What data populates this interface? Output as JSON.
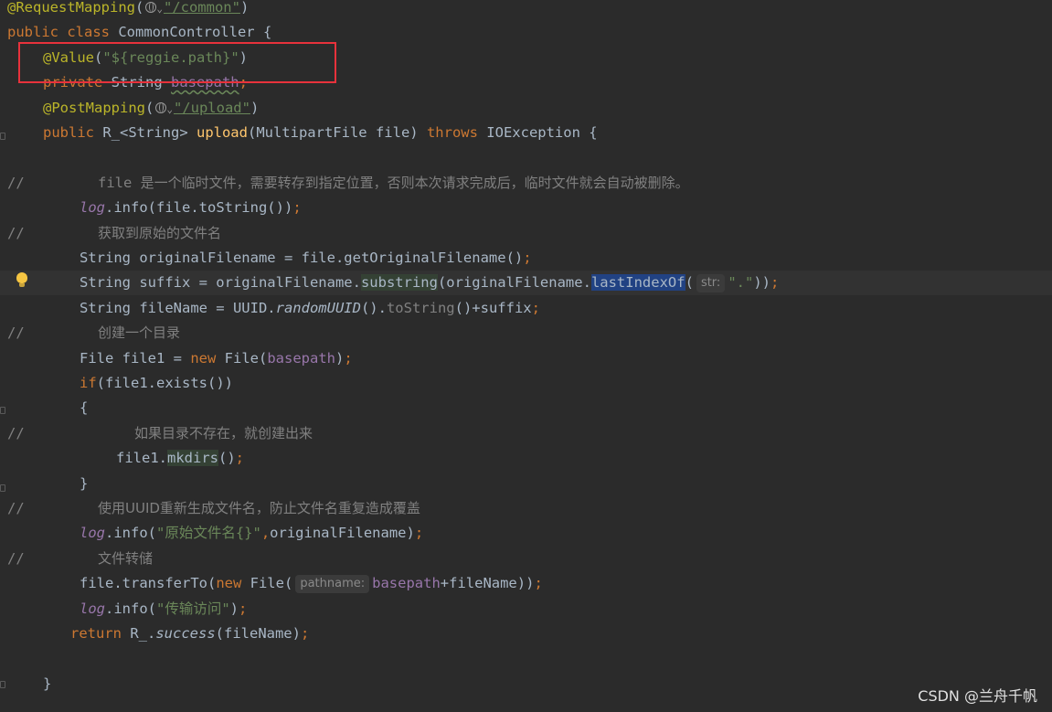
{
  "editor": {
    "lines": [
      {
        "comment": false,
        "indent": 8,
        "caret": false,
        "tokens": [
          {
            "t": "@RequestMapping",
            "c": "ann"
          },
          {
            "t": "(",
            "c": ""
          },
          {
            "t": "",
            "c": "globe"
          },
          {
            "t": "⌄",
            "c": "chev"
          },
          {
            "t": "\"/common\"",
            "c": "str uline"
          },
          {
            "t": ")",
            "c": ""
          }
        ]
      },
      {
        "comment": false,
        "indent": 8,
        "caret": false,
        "tokens": [
          {
            "t": "public class ",
            "c": "kw"
          },
          {
            "t": "CommonController {",
            "c": ""
          }
        ]
      },
      {
        "comment": false,
        "indent": 47,
        "caret": false,
        "tokens": [
          {
            "t": "@Value",
            "c": "ann"
          },
          {
            "t": "(",
            "c": ""
          },
          {
            "t": "\"${reggie.path}\"",
            "c": "str"
          },
          {
            "t": ")",
            "c": ""
          }
        ]
      },
      {
        "comment": false,
        "indent": 47,
        "caret": false,
        "tokens": [
          {
            "t": "private ",
            "c": "kw"
          },
          {
            "t": "String ",
            "c": ""
          },
          {
            "t": "basepath",
            "c": "fld squig"
          },
          {
            "t": ";",
            "c": "kw"
          }
        ]
      },
      {
        "comment": false,
        "indent": 47,
        "caret": false,
        "tokens": [
          {
            "t": "@PostMapping",
            "c": "ann"
          },
          {
            "t": "(",
            "c": ""
          },
          {
            "t": "",
            "c": "globe"
          },
          {
            "t": "⌄",
            "c": "chev"
          },
          {
            "t": "\"/upload\"",
            "c": "str uline"
          },
          {
            "t": ")",
            "c": ""
          }
        ]
      },
      {
        "comment": false,
        "indent": 47,
        "caret": false,
        "tokens": [
          {
            "t": "public ",
            "c": "kw"
          },
          {
            "t": "R_<String> ",
            "c": ""
          },
          {
            "t": "upload",
            "c": "mth"
          },
          {
            "t": "(MultipartFile file) ",
            "c": ""
          },
          {
            "t": "throws ",
            "c": "kw"
          },
          {
            "t": "IOException {",
            "c": ""
          }
        ]
      },
      {
        "comment": false,
        "indent": 47,
        "caret": false,
        "tokens": []
      },
      {
        "comment": true,
        "indent": 107,
        "caret": false,
        "tokens": [
          {
            "t": "file ",
            "c": "gray"
          },
          {
            "t": "是一个临时文件，需要转存到指定位置，否则本次请求完成后，临时文件就会自动被删除。",
            "c": "cmt"
          }
        ]
      },
      {
        "comment": false,
        "indent": 87,
        "caret": false,
        "tokens": [
          {
            "t": "log",
            "c": "fld ital"
          },
          {
            "t": ".info(file.toString())",
            "c": ""
          },
          {
            "t": ";",
            "c": "kw"
          }
        ]
      },
      {
        "comment": true,
        "indent": 107,
        "caret": false,
        "tokens": [
          {
            "t": "获取到原始的文件名",
            "c": "cmt"
          }
        ]
      },
      {
        "comment": false,
        "indent": 87,
        "caret": false,
        "tokens": [
          {
            "t": "String originalFilename = file.getOriginalFilename()",
            "c": ""
          },
          {
            "t": ";",
            "c": "kw"
          }
        ]
      },
      {
        "comment": false,
        "indent": 87,
        "caret": true,
        "tokens": [
          {
            "t": "String suffix = originalFilename.",
            "c": ""
          },
          {
            "t": "substring",
            "c": "hl"
          },
          {
            "t": "(originalFilename.",
            "c": ""
          },
          {
            "t": "lastIndexOf",
            "c": "sel"
          },
          {
            "t": "(",
            "c": ""
          },
          {
            "t": "str:",
            "c": "hint"
          },
          {
            "t": "\".\"",
            "c": "str"
          },
          {
            "t": "))",
            "c": ""
          },
          {
            "t": ";",
            "c": "kw"
          }
        ]
      },
      {
        "comment": false,
        "indent": 87,
        "caret": false,
        "tokens": [
          {
            "t": "String fileName = UUID.",
            "c": ""
          },
          {
            "t": "randomUUID",
            "c": "ital"
          },
          {
            "t": "().",
            "c": ""
          },
          {
            "t": "toString",
            "c": "gray"
          },
          {
            "t": "()+suffix",
            "c": ""
          },
          {
            "t": ";",
            "c": "kw"
          }
        ]
      },
      {
        "comment": true,
        "indent": 107,
        "caret": false,
        "tokens": [
          {
            "t": "创建一个目录",
            "c": "cmt"
          }
        ]
      },
      {
        "comment": false,
        "indent": 87,
        "caret": false,
        "tokens": [
          {
            "t": "File file1 = ",
            "c": ""
          },
          {
            "t": "new ",
            "c": "kw"
          },
          {
            "t": "File(",
            "c": ""
          },
          {
            "t": "basepath",
            "c": "fld"
          },
          {
            "t": ")",
            "c": ""
          },
          {
            "t": ";",
            "c": "kw"
          }
        ]
      },
      {
        "comment": false,
        "indent": 87,
        "caret": false,
        "tokens": [
          {
            "t": "if",
            "c": "kw"
          },
          {
            "t": "(file1.exists())",
            "c": ""
          }
        ]
      },
      {
        "comment": false,
        "indent": 87,
        "caret": false,
        "tokens": [
          {
            "t": "{",
            "c": ""
          }
        ]
      },
      {
        "comment": true,
        "indent": 147,
        "caret": false,
        "tokens": [
          {
            "t": "如果目录不存在，就创建出来",
            "c": "cmt"
          }
        ]
      },
      {
        "comment": false,
        "indent": 127,
        "caret": false,
        "tokens": [
          {
            "t": "file1.",
            "c": ""
          },
          {
            "t": "mkdirs",
            "c": "hl"
          },
          {
            "t": "()",
            "c": ""
          },
          {
            "t": ";",
            "c": "kw"
          }
        ]
      },
      {
        "comment": false,
        "indent": 87,
        "caret": false,
        "tokens": [
          {
            "t": "}",
            "c": ""
          }
        ]
      },
      {
        "comment": true,
        "indent": 107,
        "caret": false,
        "tokens": [
          {
            "t": "使用UUID重新生成文件名，防止文件名重复造成覆盖",
            "c": "cmt"
          }
        ]
      },
      {
        "comment": false,
        "indent": 87,
        "caret": false,
        "tokens": [
          {
            "t": "log",
            "c": "fld ital"
          },
          {
            "t": ".info(",
            "c": ""
          },
          {
            "t": "\"原始文件名{}\"",
            "c": "str"
          },
          {
            "t": ",",
            "c": "kw"
          },
          {
            "t": "originalFilename)",
            "c": ""
          },
          {
            "t": ";",
            "c": "kw"
          }
        ]
      },
      {
        "comment": true,
        "indent": 107,
        "caret": false,
        "tokens": [
          {
            "t": "文件转储",
            "c": "cmt"
          }
        ]
      },
      {
        "comment": false,
        "indent": 87,
        "caret": false,
        "tokens": [
          {
            "t": "file.transferTo(",
            "c": ""
          },
          {
            "t": "new ",
            "c": "kw"
          },
          {
            "t": "File(",
            "c": ""
          },
          {
            "t": "pathname:",
            "c": "hint"
          },
          {
            "t": "basepath",
            "c": "fld"
          },
          {
            "t": "+fileName))",
            "c": ""
          },
          {
            "t": ";",
            "c": "kw"
          }
        ]
      },
      {
        "comment": false,
        "indent": 87,
        "caret": false,
        "tokens": [
          {
            "t": "log",
            "c": "fld ital"
          },
          {
            "t": ".info(",
            "c": ""
          },
          {
            "t": "\"传输访问\"",
            "c": "str"
          },
          {
            "t": ")",
            "c": ""
          },
          {
            "t": ";",
            "c": "kw"
          }
        ]
      },
      {
        "comment": false,
        "indent": 77,
        "caret": false,
        "tokens": [
          {
            "t": "return ",
            "c": "kw"
          },
          {
            "t": "R_.",
            "c": ""
          },
          {
            "t": "success",
            "c": "ital"
          },
          {
            "t": "(fileName)",
            "c": ""
          },
          {
            "t": ";",
            "c": "kw"
          }
        ]
      },
      {
        "comment": false,
        "indent": 47,
        "caret": false,
        "tokens": []
      },
      {
        "comment": false,
        "indent": 47,
        "caret": false,
        "tokens": [
          {
            "t": "}",
            "c": ""
          }
        ]
      }
    ]
  },
  "gutter": {
    "comment_mark": "//"
  },
  "watermark": "CSDN @兰舟千帆",
  "icons": {
    "intention": "lightbulb-icon",
    "globe": "globe-icon"
  }
}
